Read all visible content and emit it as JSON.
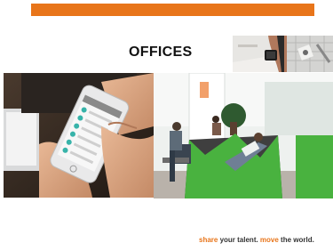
{
  "slide": {
    "title": "OFFICES",
    "accent_color": "#e8751a"
  },
  "slogan": {
    "word1": "share",
    "text1": " your talent. ",
    "word2": "move",
    "text2": " the world."
  },
  "photos": [
    "hand-holding-smartphone",
    "office-lounge-green-seating",
    "wrist-watch-detail",
    "desk-accessories-detail"
  ]
}
